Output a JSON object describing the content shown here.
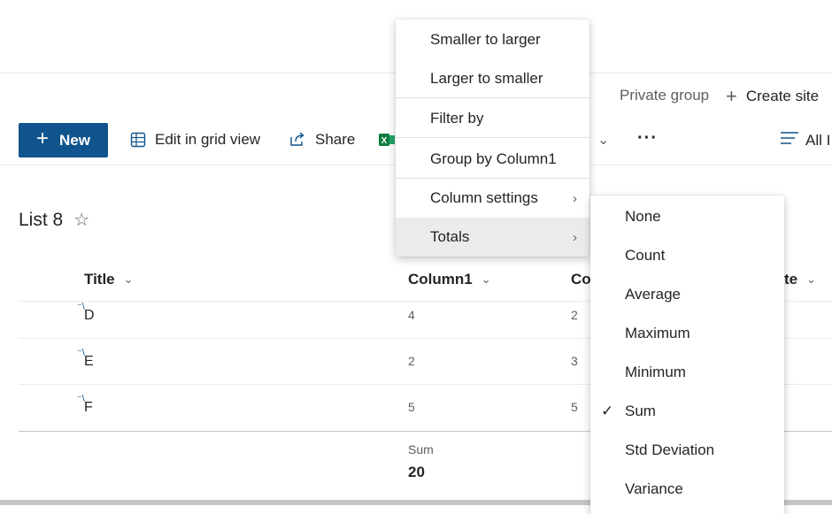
{
  "header": {
    "private_group": "Private group",
    "create_site": "Create site"
  },
  "command_bar": {
    "new_label": "New",
    "edit_grid_label": "Edit in grid view",
    "share_label": "Share",
    "all_label": "All I",
    "excel_color": "#107c41",
    "accent_color": "#0f548c"
  },
  "list": {
    "title": "List 8",
    "columns": [
      "Title",
      "Column1",
      "Co",
      "te"
    ],
    "rows": [
      {
        "title": "D",
        "column1": "4",
        "column2": "2"
      },
      {
        "title": "E",
        "column1": "2",
        "column2": "3"
      },
      {
        "title": "F",
        "column1": "5",
        "column2": "5"
      }
    ],
    "totals": {
      "label": "Sum",
      "value": "20"
    }
  },
  "context_menu": {
    "items": [
      {
        "label": "Smaller to larger"
      },
      {
        "label": "Larger to smaller"
      },
      {
        "label": "Filter by"
      },
      {
        "label": "Group by Column1"
      },
      {
        "label": "Column settings"
      },
      {
        "label": "Totals"
      }
    ]
  },
  "totals_submenu": {
    "items": [
      {
        "label": "None"
      },
      {
        "label": "Count"
      },
      {
        "label": "Average"
      },
      {
        "label": "Maximum"
      },
      {
        "label": "Minimum"
      },
      {
        "label": "Sum",
        "checked": true
      },
      {
        "label": "Std Deviation"
      },
      {
        "label": "Variance"
      }
    ]
  }
}
